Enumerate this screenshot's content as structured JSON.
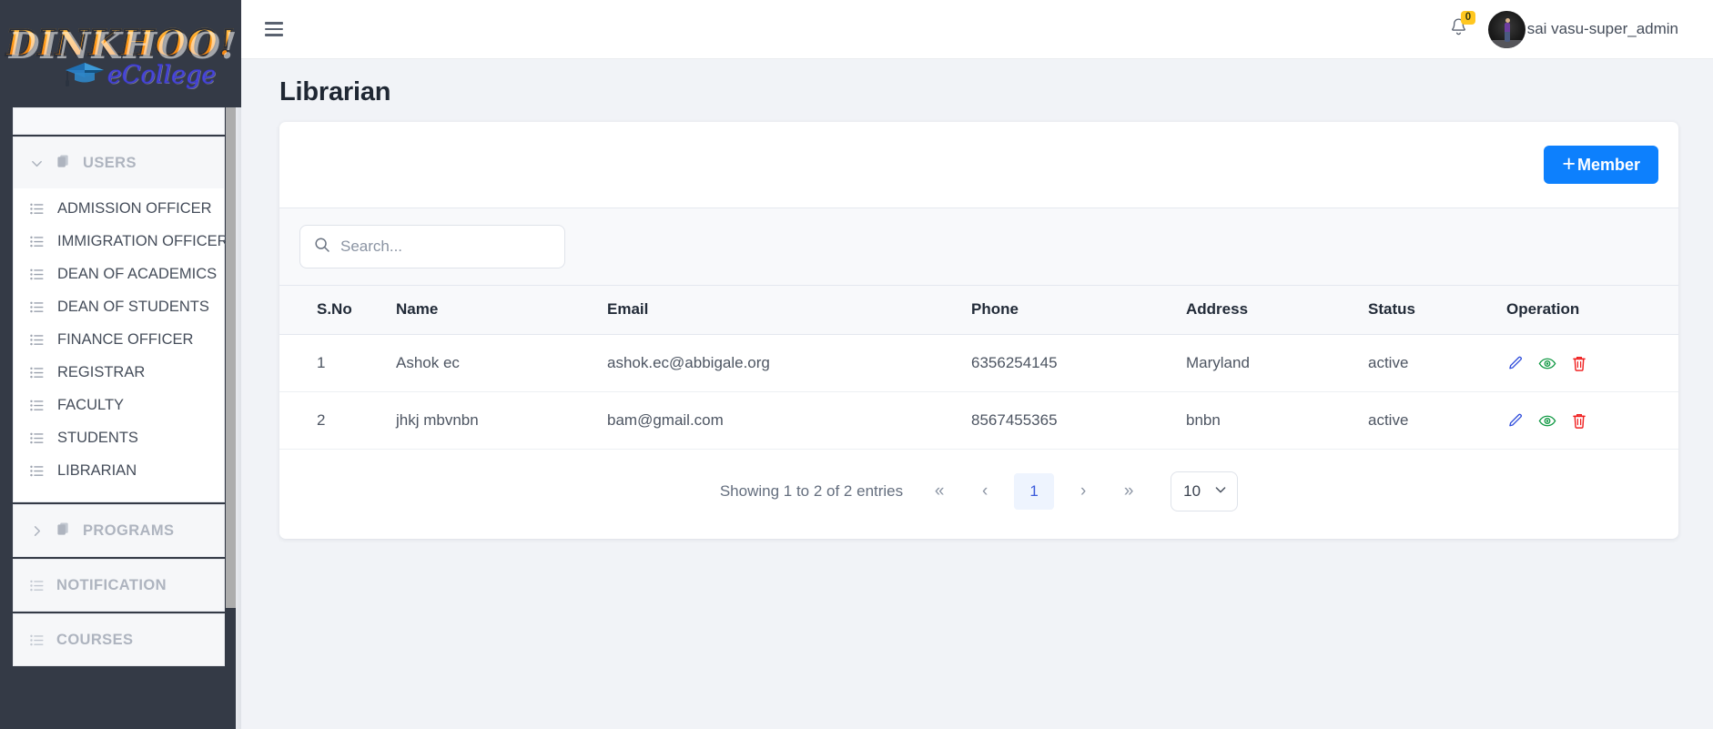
{
  "brand": {
    "logo_text": "DINKHOO!",
    "logo_sub": "eCollege",
    "cap_icon": "graduation-cap-icon"
  },
  "sidebar": {
    "groups": [
      {
        "label": "USERS",
        "icon": "copy-icon",
        "chevron": "chevron-down-icon",
        "expanded": true,
        "items": [
          {
            "label": "ADMISSION OFFICER",
            "icon": "list-icon"
          },
          {
            "label": "IMMIGRATION OFFICER",
            "icon": "list-icon"
          },
          {
            "label": "DEAN OF ACADEMICS",
            "icon": "list-icon"
          },
          {
            "label": "DEAN OF STUDENTS",
            "icon": "list-icon"
          },
          {
            "label": "FINANCE OFFICER",
            "icon": "list-icon"
          },
          {
            "label": "REGISTRAR",
            "icon": "list-icon"
          },
          {
            "label": "FACULTY",
            "icon": "list-icon"
          },
          {
            "label": "STUDENTS",
            "icon": "list-icon"
          },
          {
            "label": "LIBRARIAN",
            "icon": "list-icon"
          }
        ]
      },
      {
        "label": "PROGRAMS",
        "icon": "copy-icon",
        "chevron": "chevron-right-icon",
        "expanded": false,
        "items": []
      }
    ],
    "simple_items": [
      {
        "label": "NOTIFICATION",
        "icon": "list-icon"
      },
      {
        "label": "COURSES",
        "icon": "list-icon"
      }
    ]
  },
  "topbar": {
    "menu_icon": "hamburger-icon",
    "bell_icon": "bell-icon",
    "notification_count": "0",
    "user_name": "sai vasu-super_admin",
    "avatar": "user-avatar"
  },
  "page": {
    "title": "Librarian"
  },
  "toolbar": {
    "add_member_label": "Member",
    "add_member_plus": "+"
  },
  "search": {
    "placeholder": "Search...",
    "value": "",
    "icon": "search-icon"
  },
  "table": {
    "columns": [
      "S.No",
      "Name",
      "Email",
      "Phone",
      "Address",
      "Status",
      "Operation"
    ],
    "rows": [
      {
        "sno": "1",
        "name": "Ashok ec",
        "email": "ashok.ec@abbigale.org",
        "phone": "6356254145",
        "address": "Maryland",
        "status": "active"
      },
      {
        "sno": "2",
        "name": "jhkj mbvnbn",
        "email": "bam@gmail.com",
        "phone": "8567455365",
        "address": "bnbn",
        "status": "active"
      }
    ],
    "operations": [
      {
        "name": "edit-icon",
        "color": "#2f4ddb"
      },
      {
        "name": "view-icon",
        "color": "#119944"
      },
      {
        "name": "delete-icon",
        "color": "#f02020"
      }
    ]
  },
  "pagination": {
    "entries_text": "Showing 1 to 2 of 2 entries",
    "first_label": "«",
    "prev_label": "‹",
    "pages": [
      "1"
    ],
    "current_page": "1",
    "next_label": "›",
    "last_label": "»",
    "page_size": "10",
    "page_size_chevron": "chevron-down-icon"
  },
  "colors": {
    "accent_blue": "#0d80fd",
    "badge_yellow": "#ffc720",
    "sidebar_dark": "#343a46",
    "page_bg": "#f1f3f7"
  }
}
